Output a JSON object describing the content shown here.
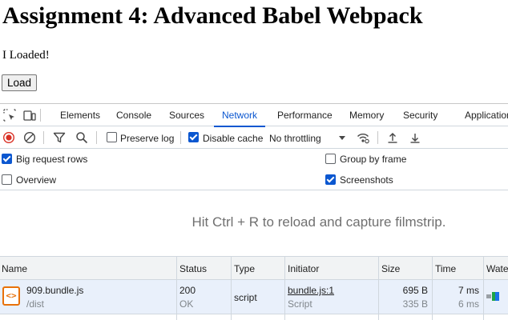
{
  "page": {
    "title": "Assignment 4: Advanced Babel Webpack",
    "status_text": "I Loaded!",
    "load_button": "Load"
  },
  "devtools": {
    "tabs": [
      "Elements",
      "Console",
      "Sources",
      "Network",
      "Performance",
      "Memory",
      "Security",
      "Application"
    ],
    "active_tab": "Network",
    "toolbar": {
      "preserve_log": "Preserve log",
      "preserve_log_checked": false,
      "disable_cache": "Disable cache",
      "disable_cache_checked": true,
      "throttling": "No throttling"
    },
    "settings": {
      "big_request_rows": "Big request rows",
      "big_request_rows_checked": true,
      "group_by_frame": "Group by frame",
      "group_by_frame_checked": false,
      "overview": "Overview",
      "overview_checked": false,
      "screenshots": "Screenshots",
      "screenshots_checked": true
    },
    "filmstrip_message": "Hit Ctrl + R to reload and capture filmstrip.",
    "table": {
      "columns": [
        "Name",
        "Status",
        "Type",
        "Initiator",
        "Size",
        "Time",
        "Waterfall"
      ],
      "rows": [
        {
          "name": "909.bundle.js",
          "path": "/dist",
          "status": "200",
          "status_text": "OK",
          "type": "script",
          "initiator": "bundle.js:1",
          "initiator_type": "Script",
          "size": "695 B",
          "resource_size": "335 B",
          "time": "7 ms",
          "latency": "6 ms"
        }
      ]
    },
    "colors": {
      "accent": "#0b57d0",
      "record": "#d93025",
      "js_file": "#e8710a"
    }
  }
}
